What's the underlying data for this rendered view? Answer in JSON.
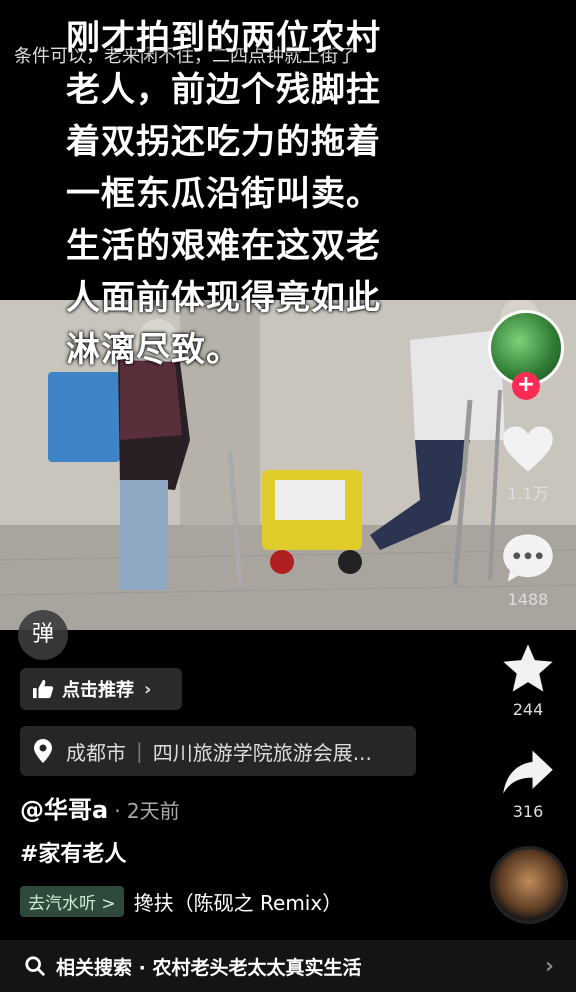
{
  "video": {
    "subtitle": "条件可以，老来闲不住，二四点钟就上街了",
    "overlay_lines": [
      "刚才拍到的两位农村",
      "老人，前边个残脚拄",
      "着双拐还吃力的拖着",
      "一框东瓜沿街叫卖。",
      "生活的艰难在这双老",
      "人面前体现得竟如此",
      "淋漓尽致。"
    ]
  },
  "rail": {
    "follow_symbol": "+",
    "likes": "1.1万",
    "comments": "1488",
    "favorites": "244",
    "shares": "316"
  },
  "danmu_label": "弹",
  "recommend_label": "点击推荐",
  "location": {
    "city": "成都市",
    "place": "四川旅游学院旅游会展..."
  },
  "author": {
    "name": "@华哥a",
    "time": "· 2天前"
  },
  "hashtag": "#家有老人",
  "music": {
    "tag": "去汽水听 >",
    "title": "搀扶（陈砚之 Remix）"
  },
  "search": {
    "label": "相关搜索 · 农村老头老太太真实生活"
  },
  "colors": {
    "accent": "#fe2c55",
    "background": "#000000"
  }
}
